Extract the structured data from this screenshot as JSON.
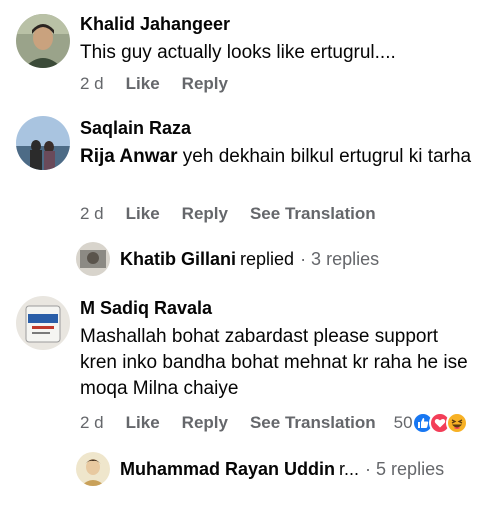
{
  "comments": [
    {
      "author": "Khalid Jahangeer",
      "text": "This guy actually looks like ertugrul....",
      "time": "2 d",
      "like": "Like",
      "reply": "Reply"
    },
    {
      "author": "Saqlain Raza",
      "mention": "Rija Anwar",
      "text": " yeh dekhain bilkul ertugrul ki tarha",
      "time": "2 d",
      "like": "Like",
      "reply": "Reply",
      "translate": "See Translation",
      "replies": {
        "author": "Khatib Gillani",
        "verb": "replied",
        "count": "· 3 replies"
      }
    },
    {
      "author": "M Sadiq Ravala",
      "text": "Mashallah bohat zabardast please support kren inko bandha bohat mehnat kr raha he ise moqa Milna chaiye",
      "time": "2 d",
      "like": "Like",
      "reply": "Reply",
      "translate": "See Translation",
      "reaction_count": "50",
      "reaction_icons": [
        "like-reaction-icon",
        "love-reaction-icon",
        "haha-reaction-icon"
      ],
      "replies": {
        "author": "Muhammad Rayan Uddin",
        "verb": "r...",
        "count": "· 5 replies"
      }
    }
  ],
  "colors": {
    "secondary_text": "#65676b",
    "like_blue": "#1877f2",
    "love_red": "#f33e58",
    "haha_yellow": "#f7b125"
  }
}
